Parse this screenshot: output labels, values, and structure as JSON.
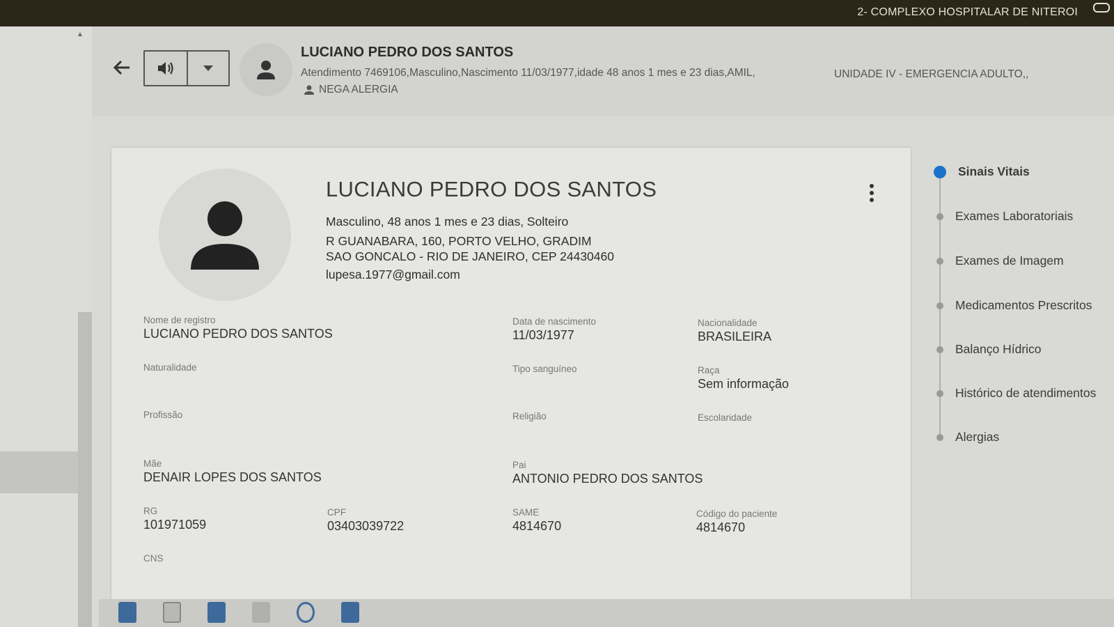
{
  "topbar": {
    "hospital": "2- COMPLEXO HOSPITALAR DE NITEROI"
  },
  "header": {
    "patient_name": "LUCIANO PEDRO DOS SANTOS",
    "info": "Atendimento 7469106,Masculino,Nascimento 11/03/1977,idade 48 anos 1 mes e 23 dias,AMIL,",
    "unit": "UNIDADE IV - EMERGENCIA ADULTO,,",
    "allergy": "NEGA ALERGIA",
    "back_icon": "arrow-left-icon",
    "speaker_icon": "speaker-icon",
    "dropdown_icon": "caret-down-icon"
  },
  "card": {
    "name": "LUCIANO PEDRO DOS SANTOS",
    "summary": "Masculino, 48 anos 1 mes e 23 dias, Solteiro",
    "address_line1": "R GUANABARA, 160, PORTO VELHO, GRADIM",
    "address_line2": "SAO GONCALO - RIO DE JANEIRO, CEP 24430460",
    "email": "lupesa.1977@gmail.com",
    "fields": {
      "nome_registro": {
        "label": "Nome de registro",
        "value": "LUCIANO PEDRO DOS SANTOS"
      },
      "data_nascimento": {
        "label": "Data de nascimento",
        "value": "11/03/1977"
      },
      "nacionalidade": {
        "label": "Nacionalidade",
        "value": "BRASILEIRA"
      },
      "naturalidade": {
        "label": "Naturalidade",
        "value": ""
      },
      "tipo_sanguineo": {
        "label": "Tipo sanguíneo",
        "value": ""
      },
      "raca": {
        "label": "Raça",
        "value": "Sem informação"
      },
      "profissao": {
        "label": "Profissão",
        "value": ""
      },
      "religiao": {
        "label": "Religião",
        "value": ""
      },
      "escolaridade": {
        "label": "Escolaridade",
        "value": ""
      },
      "mae": {
        "label": "Mãe",
        "value": "DENAIR LOPES DOS SANTOS"
      },
      "pai": {
        "label": "Pai",
        "value": "ANTONIO PEDRO DOS SANTOS"
      },
      "rg": {
        "label": "RG",
        "value": "101971059"
      },
      "cpf": {
        "label": "CPF",
        "value": "03403039722"
      },
      "same": {
        "label": "SAME",
        "value": "4814670"
      },
      "codigo_paciente": {
        "label": "Código do paciente",
        "value": "4814670"
      },
      "cns": {
        "label": "CNS",
        "value": ""
      }
    }
  },
  "timeline": {
    "items": [
      {
        "label": "Sinais Vitais",
        "active": true
      },
      {
        "label": "Exames Laboratoriais",
        "active": false
      },
      {
        "label": "Exames de Imagem",
        "active": false
      },
      {
        "label": "Medicamentos Prescritos",
        "active": false
      },
      {
        "label": "Balanço Hídrico",
        "active": false
      },
      {
        "label": "Histórico de atendimentos",
        "active": false
      },
      {
        "label": "Alergias",
        "active": false
      }
    ]
  },
  "colors": {
    "accent": "#1a73c8",
    "topbar": "#2b2618"
  }
}
